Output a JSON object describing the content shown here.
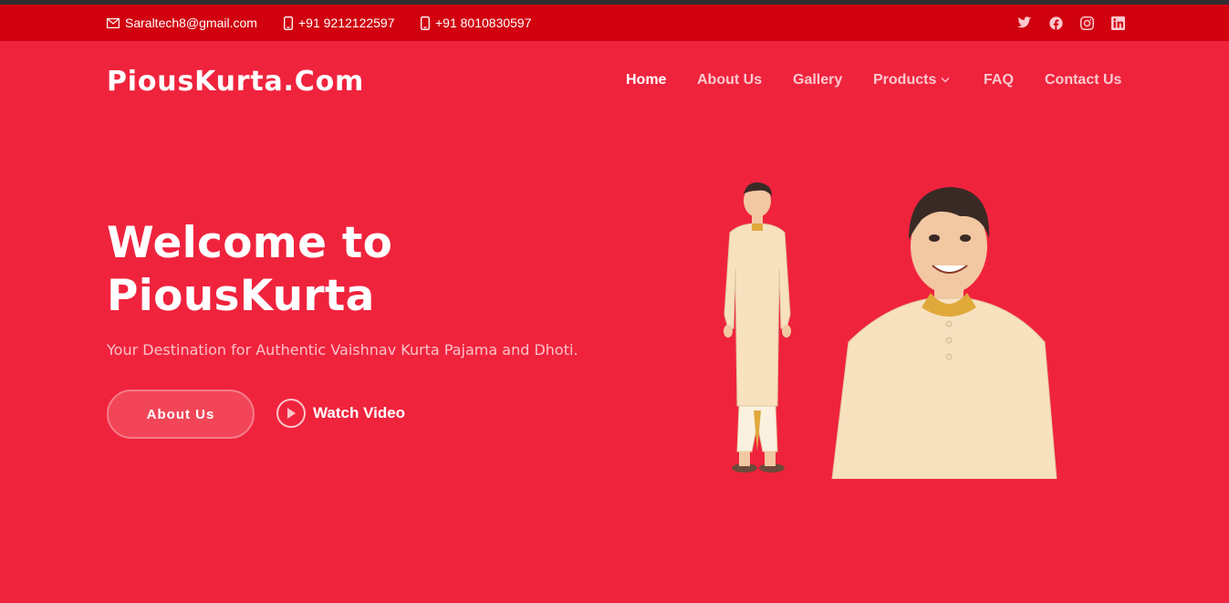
{
  "topbar": {
    "email": "Saraltech8@gmail.com",
    "phone1": "+91 9212122597",
    "phone2": "+91 8010830597",
    "social": [
      "twitter-icon",
      "facebook-icon",
      "instagram-icon",
      "linkedin-icon"
    ]
  },
  "brand": {
    "name": "PiousKurta.Com"
  },
  "nav": {
    "items": [
      {
        "label": "Home",
        "active": true
      },
      {
        "label": "About Us"
      },
      {
        "label": "Gallery"
      },
      {
        "label": "Products",
        "dropdown": true
      },
      {
        "label": "FAQ"
      },
      {
        "label": "Contact Us"
      }
    ]
  },
  "hero": {
    "title": "Welcome to PiousKurta",
    "subtitle": "Your Destination for Authentic Vaishnav Kurta Pajama and Dhoti.",
    "cta_label": "About Us",
    "video_label": "Watch Video"
  },
  "colors": {
    "background": "#f0233d",
    "topbar": "#d1010f"
  }
}
